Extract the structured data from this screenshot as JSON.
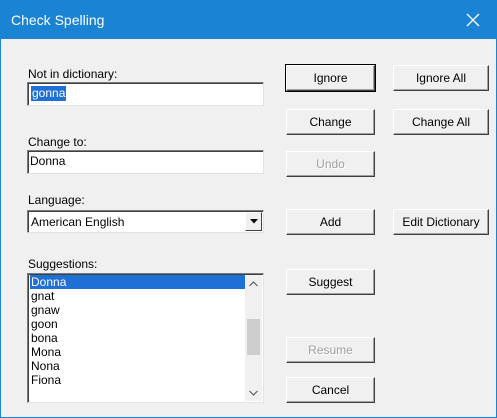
{
  "window": {
    "title": "Check Spelling"
  },
  "not_in_dictionary": {
    "label": "Not in dictionary:",
    "value": "gonna"
  },
  "change_to": {
    "label": "Change to:",
    "value": "Donna"
  },
  "language": {
    "label": "Language:",
    "selected": "American English"
  },
  "suggestions": {
    "label": "Suggestions:",
    "items": [
      "Donna",
      "gnat",
      "gnaw",
      "goon",
      "bona",
      "Mona",
      "Nona",
      "Fiona"
    ],
    "selected_index": 0
  },
  "buttons": {
    "ignore": "Ignore",
    "ignore_all": "Ignore All",
    "change": "Change",
    "change_all": "Change All",
    "undo": "Undo",
    "add": "Add",
    "edit_dictionary": "Edit Dictionary",
    "suggest": "Suggest",
    "resume": "Resume",
    "cancel": "Cancel"
  },
  "colors": {
    "titlebar": "#1a83d4",
    "selection": "#1e6fd6",
    "disabled_text": "#a0a0a0"
  },
  "icons": {
    "close": "close-icon",
    "combo": "chevron-down-icon",
    "scroll_up": "chevron-up-icon",
    "scroll_down": "chevron-down-icon"
  }
}
